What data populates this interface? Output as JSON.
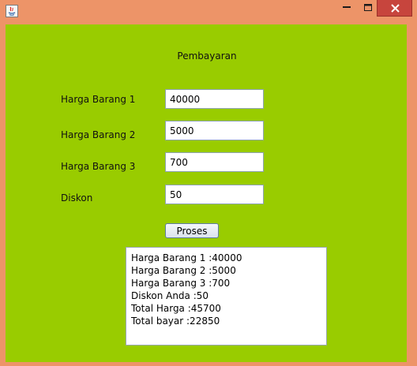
{
  "window": {
    "title": "",
    "frame_color": "#ED9468",
    "panel_color": "#99CC00",
    "close_color": "#C7453D"
  },
  "icons": {
    "app": "java-icon",
    "minimize": "minimize-icon",
    "maximize": "maximize-icon",
    "close": "close-icon"
  },
  "form": {
    "title": "Pembayaran",
    "fields": [
      {
        "label": "Harga Barang 1",
        "value": "40000"
      },
      {
        "label": "Harga Barang 2",
        "value": "5000"
      },
      {
        "label": "Harga Barang 3",
        "value": "700"
      },
      {
        "label": "Diskon",
        "value": "50"
      }
    ],
    "button_label": "Proses"
  },
  "output": {
    "lines": [
      "Harga Barang 1 :40000",
      "Harga Barang 2 :5000",
      "Harga Barang 3 :700",
      "Diskon Anda :50",
      "Total Harga :45700",
      "Total bayar :22850"
    ]
  }
}
